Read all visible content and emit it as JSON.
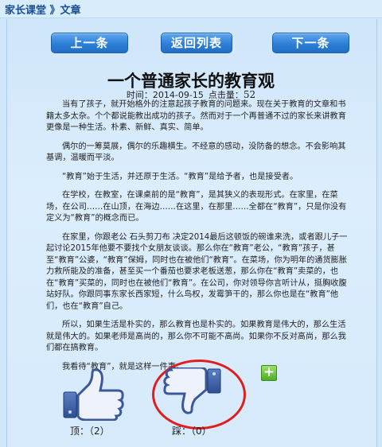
{
  "breadcrumb": "家长课堂 》文章",
  "nav": {
    "prev_label": "上一条",
    "back_label": "返回列表",
    "next_label": "下一条"
  },
  "article": {
    "title": "一个普通家长的教育观",
    "time_label": "时间：",
    "date": "2014-09-15",
    "hits_label": "点击量：",
    "hits": "52",
    "paragraphs": [
      "当有了孩子，就开始格外的注意起孩子教育的问题来。现在关于教育的文章和书籍太多太杂。个个都说能教出成功的孩子。然而对于一个再普通不过的家长来讲教育更像是一种生活。朴素、新鲜、真实、简单。",
      "偶尔的一筹莫展，偶尔的乐趣横生。不经意的感动，没防备的想念。不会影响其基调，温暖而平淡。",
      "“教育”始于生活，并还原于生活。“教育”是给予者，也是接受者。",
      "在学校，在教室，在课桌前的是“教育”，是其狭义的表现形式。在家里，在菜场，在公司……在山顶，在海边……在这里，在那里……全都在“教育”，只是你没有定义为“教育”的概念而已。",
      "在家里，你跟老公 石头剪刀布 决定2014最后这顿饭的碗谁来洗，或者跟儿子一起讨论2015年他要不要找个女朋友谈谈。那么你在“教育”老公，“教育”孩子，甚至“教育”公婆，“教育”保姆，同时也在被他们“教育”。在菜场，你为明年的通货膨胀力救所能及的准备，甚至买一个番茄也要求老板送葱，那么你在“教育”卖菜的，也在“教育”买菜的，同时也在被他们“教育”。在公司，你对领导你言听计从，挺胸收腹站好队。你跟同事东家长西家短，什么鸟权，发霉笋干的，那么你也是在“教育”他们，也在“教育”自己。",
      "所以，如果生活是朴实的，那么教育也是朴实的。如果教育是伟大的，那么生活就是伟大的。如果老师是高尚的，那么你不可能不高尚。如果你不反对高尚，那么我们都在搞教育。",
      "我看待“教育”，就是这样一件事。"
    ]
  },
  "vote": {
    "up_label": "顶：（2）",
    "down_label": "踩：（0）",
    "up_count": 2,
    "down_count": 0
  },
  "icons": {
    "up": "thumbs-up-icon",
    "down": "thumbs-down-icon",
    "plus": "plus-icon"
  },
  "colors": {
    "button": "#2d7fd6",
    "highlight_circle": "#e01e1e",
    "thumb_blue": "#3b5998",
    "plus_green": "#4cae25"
  }
}
